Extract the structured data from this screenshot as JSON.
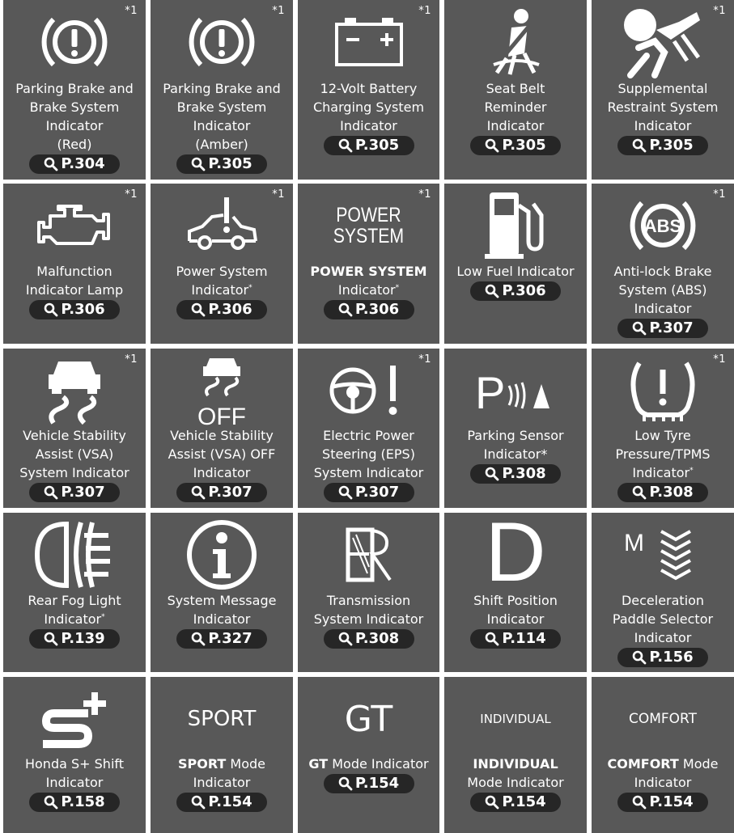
{
  "cells": [
    {
      "mark": "*1",
      "lines": [
        "Parking Brake and",
        "Brake System",
        "Indicator",
        "(Red)"
      ],
      "ref": "P.304",
      "icon": "brake-warning-icon"
    },
    {
      "mark": "*1",
      "lines": [
        "Parking Brake and",
        "Brake System",
        "Indicator",
        "(Amber)"
      ],
      "ref": "P.305",
      "icon": "brake-warning-icon"
    },
    {
      "mark": "*1",
      "lines": [
        "12-Volt Battery",
        "Charging System",
        "Indicator"
      ],
      "ref": "P.305",
      "icon": "battery-icon"
    },
    {
      "mark": "",
      "lines": [
        "Seat Belt",
        "Reminder",
        "Indicator"
      ],
      "ref": "P.305",
      "icon": "seat-belt-icon"
    },
    {
      "mark": "*1",
      "lines": [
        "Supplemental",
        "Restraint System",
        "Indicator"
      ],
      "ref": "P.305",
      "icon": "airbag-icon"
    },
    {
      "mark": "*1",
      "lines": [
        "Malfunction",
        "Indicator Lamp"
      ],
      "ref": "P.306",
      "icon": "engine-icon"
    },
    {
      "mark": "*1",
      "lines": [
        "Power System",
        "Indicator"
      ],
      "sup": "*",
      "ref": "P.306",
      "icon": "car-warning-icon"
    },
    {
      "mark": "*1",
      "lines": [
        "POWER SYSTEM",
        "Indicator"
      ],
      "bold_first": "POWER SYSTEM",
      "sup": "*",
      "ref": "P.306",
      "icon": "power-system-text-icon",
      "icon_text": [
        "POWER",
        "SYSTEM"
      ]
    },
    {
      "mark": "",
      "lines": [
        "Low Fuel Indicator"
      ],
      "ref": "P.306",
      "icon": "fuel-pump-icon"
    },
    {
      "mark": "*1",
      "lines": [
        "Anti-lock Brake",
        "System (ABS)",
        "Indicator"
      ],
      "ref": "P.307",
      "icon": "abs-icon",
      "icon_text": [
        "ABS"
      ]
    },
    {
      "mark": "*1",
      "lines": [
        "Vehicle Stability",
        "Assist (VSA)",
        "System Indicator"
      ],
      "ref": "P.307",
      "icon": "vsa-icon"
    },
    {
      "mark": "",
      "lines": [
        "Vehicle Stability",
        "Assist (VSA) OFF",
        "Indicator"
      ],
      "ref": "P.307",
      "icon": "vsa-off-icon",
      "icon_text": [
        "OFF"
      ]
    },
    {
      "mark": "*1",
      "lines": [
        "Electric Power",
        "Steering (EPS)",
        "System Indicator"
      ],
      "ref": "P.307",
      "icon": "steering-wheel-icon"
    },
    {
      "mark": "",
      "lines": [
        "Parking Sensor",
        "Indicator*"
      ],
      "ref": "P.308",
      "icon": "parking-sensor-icon",
      "icon_text": [
        "P"
      ]
    },
    {
      "mark": "*1",
      "lines": [
        "Low Tyre",
        "Pressure/TPMS",
        "Indicator"
      ],
      "sup": "*",
      "ref": "P.308",
      "icon": "tyre-pressure-icon"
    },
    {
      "mark": "",
      "lines": [
        "Rear Fog Light",
        "Indicator"
      ],
      "sup": "*",
      "ref": "P.139",
      "icon": "rear-fog-icon"
    },
    {
      "mark": "",
      "lines": [
        "System Message",
        "Indicator"
      ],
      "ref": "P.327",
      "icon": "info-icon"
    },
    {
      "mark": "",
      "lines": [
        "Transmission",
        "System Indicator"
      ],
      "ref": "P.308",
      "icon": "transmission-icon"
    },
    {
      "mark": "",
      "lines": [
        "Shift Position",
        "Indicator"
      ],
      "ref": "P.114",
      "icon": "shift-d-icon",
      "icon_text": [
        "D"
      ]
    },
    {
      "mark": "",
      "lines": [
        "Deceleration",
        "Paddle Selector",
        "Indicator"
      ],
      "ref": "P.156",
      "icon": "paddle-selector-icon",
      "icon_text": [
        "M"
      ]
    },
    {
      "mark": "",
      "lines": [
        "Honda S+ Shift",
        "Indicator"
      ],
      "ref": "P.158",
      "icon": "s-plus-icon"
    },
    {
      "mark": "",
      "lines": [
        "SPORT Mode",
        "Indicator"
      ],
      "bold_first": "SPORT",
      "ref": "P.154",
      "icon": "sport-text-icon",
      "icon_text": [
        "SPORT"
      ]
    },
    {
      "mark": "",
      "lines": [
        "GT Mode Indicator"
      ],
      "bold_first": "GT",
      "ref": "P.154",
      "icon": "gt-text-icon",
      "icon_text": [
        "GT"
      ]
    },
    {
      "mark": "",
      "lines": [
        "INDIVIDUAL",
        "Mode Indicator"
      ],
      "bold_first": "INDIVIDUAL",
      "ref": "P.154",
      "icon": "individual-text-icon",
      "icon_text": [
        "INDIVIDUAL"
      ]
    },
    {
      "mark": "",
      "lines": [
        "COMFORT Mode",
        "Indicator"
      ],
      "bold_first": "COMFORT",
      "ref": "P.154",
      "icon": "comfort-text-icon",
      "icon_text": [
        "COMFORT"
      ]
    }
  ]
}
